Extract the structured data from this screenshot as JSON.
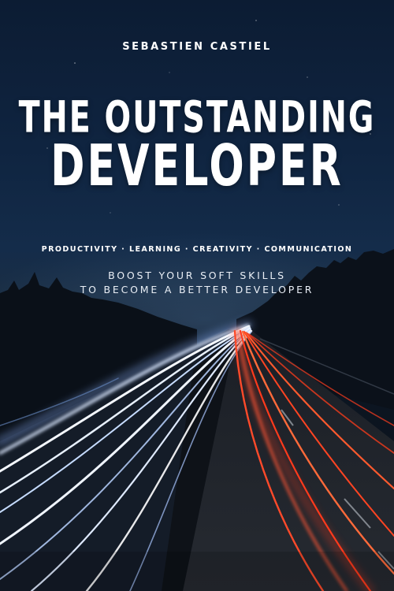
{
  "cover": {
    "author": "SEBASTIEN CASTIEL",
    "title_line1": "THE OUTSTANDING",
    "title_line2": "DEVELOPER",
    "topics": "PRODUCTIVITY · LEARNING · CREATIVITY · COMMUNICATION",
    "subtitle_line1": "BOOST YOUR SOFT SKILLS",
    "subtitle_line2": "TO BECOME A BETTER DEVELOPER"
  },
  "colors": {
    "sky_top": "#0c1c33",
    "text": "#ffffff",
    "headlight_trails": "#e8f1ff",
    "taillight_trails": "#ff4a2a"
  }
}
